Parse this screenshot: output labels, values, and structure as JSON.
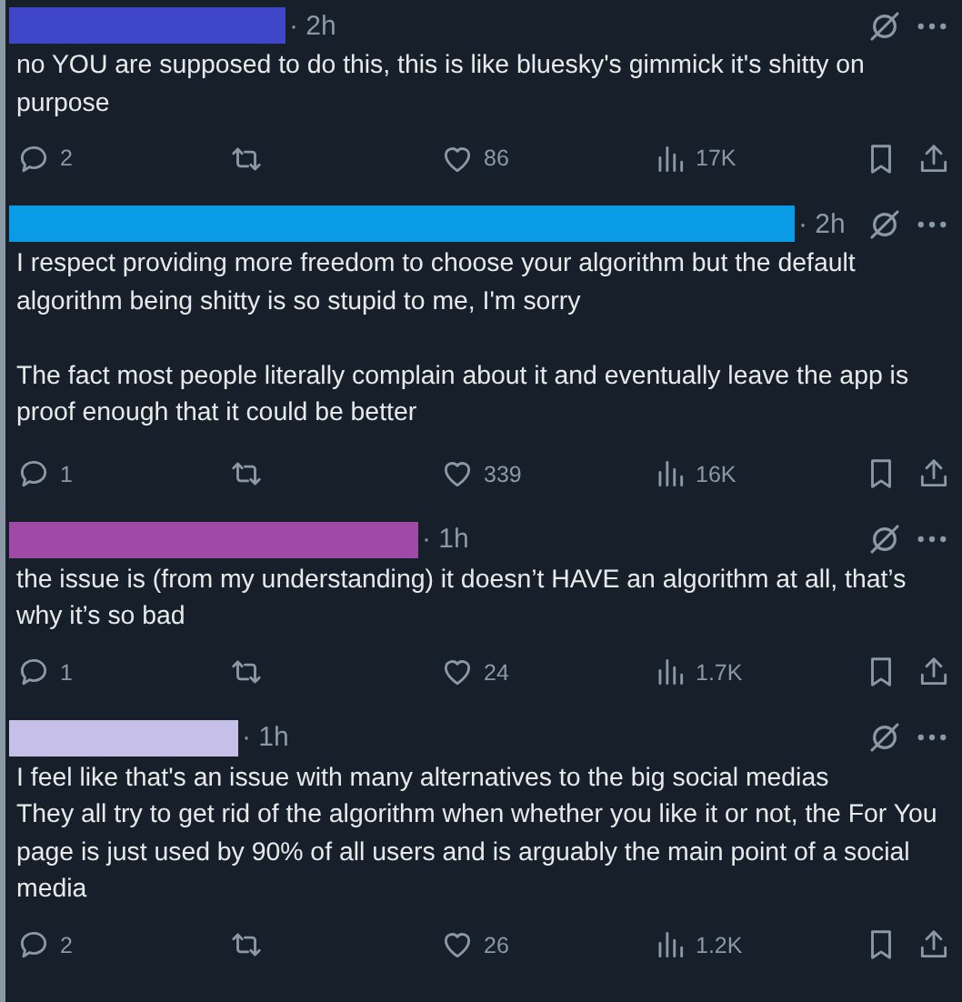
{
  "posts": [
    {
      "name_redaction": {
        "color": "#3f46c8"
      },
      "time": "· 2h",
      "text": "no YOU are supposed to do this, this is like bluesky's gimmick it's shitty on purpose",
      "actions": {
        "replies": "2",
        "likes": "86",
        "views": "17K"
      }
    },
    {
      "name_redaction": {
        "color": "#0a9be6"
      },
      "time": "· 2h",
      "text": "I respect providing more freedom to choose your algorithm but the default algorithm being shitty is so stupid to me, I'm sorry\n\nThe fact most people literally complain about it and eventually leave the app is proof enough that it could be better",
      "actions": {
        "replies": "1",
        "likes": "339",
        "views": "16K"
      }
    },
    {
      "name_redaction": {
        "color": "#a04aa8"
      },
      "time": "· 1h",
      "text": "the issue is (from my understanding) it doesn’t HAVE an algorithm at all, that’s why it’s so bad",
      "actions": {
        "replies": "1",
        "likes": "24",
        "views": "1.7K"
      }
    },
    {
      "name_redaction": {
        "color": "#c6bfe8"
      },
      "time": "· 1h",
      "text": "I feel like that's an issue with many alternatives to the big social medias\nThey all try to get rid of the algorithm when whether you like it or not, the For You page is just used by 90% of all users and is arguably the main point of a social media",
      "actions": {
        "replies": "2",
        "likes": "26",
        "views": "1.2K"
      }
    }
  ]
}
